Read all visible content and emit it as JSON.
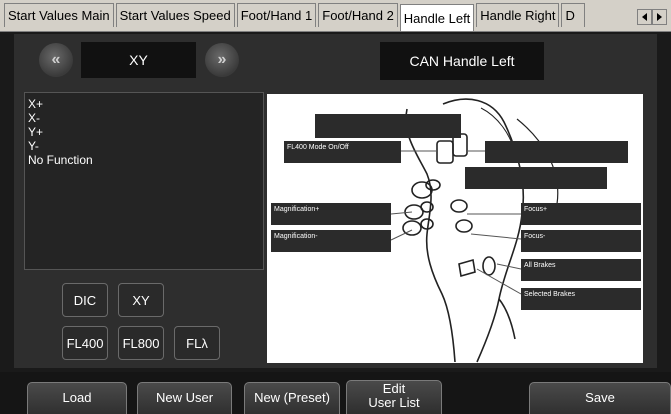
{
  "tabs": [
    {
      "label": "Start Values Main"
    },
    {
      "label": "Start Values Speed"
    },
    {
      "label": "Foot/Hand 1"
    },
    {
      "label": "Foot/Hand 2"
    },
    {
      "label": "Handle Left"
    },
    {
      "label": "Handle Right"
    },
    {
      "label": "D"
    }
  ],
  "selector": {
    "prev_label": "«",
    "next_label": "»",
    "current": "XY",
    "title": "CAN Handle Left"
  },
  "functions": [
    "X+",
    "X-",
    "Y+",
    "Y-",
    "No Function"
  ],
  "func_buttons": [
    "DIC",
    "XY",
    "FL400",
    "FL800",
    "FLλ"
  ],
  "diagram_labels": {
    "fl400_mode": "FL400 Mode On/Off",
    "mag_plus": "Magnification+",
    "mag_minus": "Magnification-",
    "focus_plus": "Focus+",
    "focus_minus": "Focus-",
    "all_brakes": "All Brakes",
    "selected_brakes": "Selected Brakes"
  },
  "bottom": {
    "load": "Load",
    "new_user": "New User",
    "new_preset": "New (Preset)",
    "edit_line1": "Edit",
    "edit_line2": "User List",
    "save": "Save"
  }
}
